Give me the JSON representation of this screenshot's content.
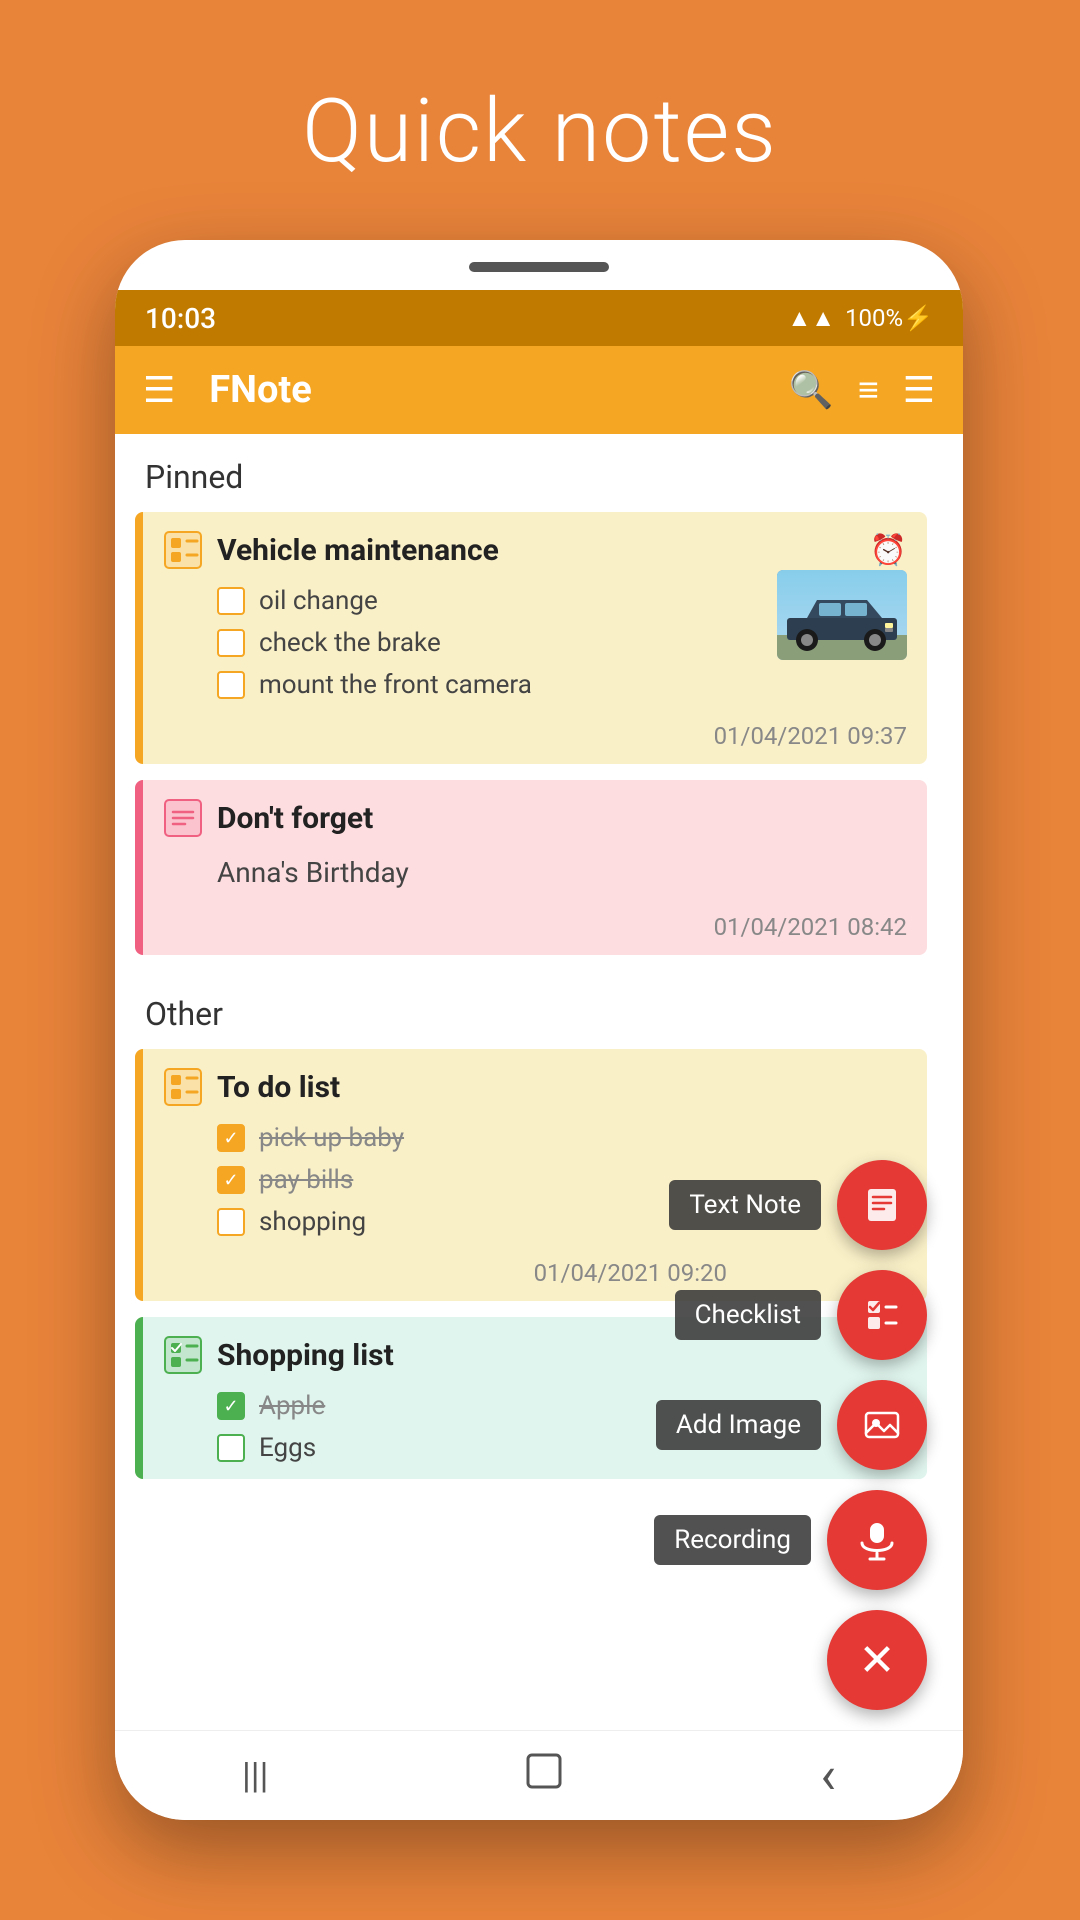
{
  "app": {
    "page_title": "Quick notes",
    "app_name": "FNote"
  },
  "status_bar": {
    "time": "10:03",
    "signal": "▲▲▲",
    "battery": "100%⚡"
  },
  "toolbar": {
    "menu_icon": "☰",
    "search_icon": "🔍",
    "sort_icon": "⇅",
    "list_icon": "☰"
  },
  "sections": [
    {
      "label": "Pinned",
      "notes": [
        {
          "id": "vehicle-maintenance",
          "type": "checklist",
          "color": "yellow",
          "title": "Vehicle maintenance",
          "has_alarm": true,
          "has_image": true,
          "items": [
            {
              "text": "oil change",
              "checked": false,
              "strikethrough": false
            },
            {
              "text": "check the brake",
              "checked": false,
              "strikethrough": false
            },
            {
              "text": "mount the front camera",
              "checked": false,
              "strikethrough": false
            }
          ],
          "timestamp": "01/04/2021 09:37"
        },
        {
          "id": "dont-forget",
          "type": "text",
          "color": "pink",
          "title": "Don't forget",
          "body": "Anna's Birthday",
          "timestamp": "01/04/2021 08:42"
        }
      ]
    },
    {
      "label": "Other",
      "notes": [
        {
          "id": "todo-list",
          "type": "checklist",
          "color": "yellow",
          "title": "To do list",
          "items": [
            {
              "text": "pick up baby",
              "checked": true,
              "strikethrough": true
            },
            {
              "text": "pay bills",
              "checked": true,
              "strikethrough": true
            },
            {
              "text": "shopping",
              "checked": false,
              "strikethrough": false
            }
          ],
          "timestamp": "01/04/2021 09:20"
        },
        {
          "id": "shopping-list",
          "type": "checklist",
          "color": "green",
          "title": "Shopping list",
          "items": [
            {
              "text": "Apple",
              "checked": true,
              "strikethrough": true
            },
            {
              "text": "Eggs",
              "checked": false,
              "strikethrough": false
            }
          ],
          "timestamp": ""
        }
      ]
    }
  ],
  "fab": {
    "text_note_label": "Text Note",
    "checklist_label": "Checklist",
    "add_image_label": "Add Image",
    "recording_label": "Recording",
    "close_icon": "✕"
  },
  "nav": {
    "back": "‹",
    "home": "⬜",
    "recent": "|||"
  }
}
